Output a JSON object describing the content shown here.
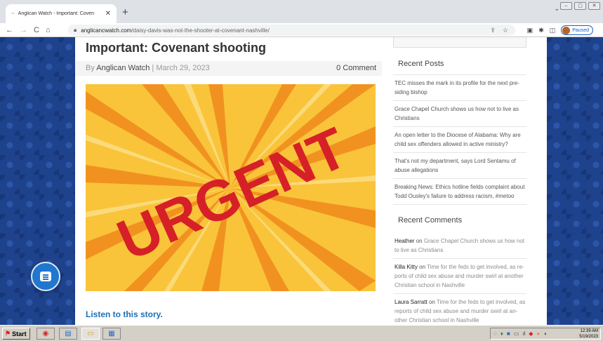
{
  "browser": {
    "tab_title": "Anglican Watch - Important: Coven",
    "tab_close": "✕",
    "new_tab": "+",
    "url_host": "anglicancwatch.com",
    "url_path": "/daisy-davis-was-not-the-shooter-at-covenant-nashville/",
    "profile_status": "Paused",
    "nav": {
      "back": "←",
      "forward": "→",
      "reload": "C",
      "home": "⌂"
    }
  },
  "post": {
    "title": "Important: Covenant shooting",
    "by_label": "By",
    "author": "Anglican Watch",
    "separator": "|",
    "date": "March 29, 2023",
    "comments": "0 Comment",
    "image_text": "URGENT",
    "listen_link": "Listen to this story."
  },
  "sidebar": {
    "recent_posts_title": "Recent Posts",
    "recent_posts": [
      "TEC misses the mark in its profile for the next pre-siding bishop",
      "Grace Chapel Church shows us how not to live as Christians",
      "An open letter to the Diocese of Alabama: Why are child sex offenders allowed in active ministry?",
      "That's not my department, says Lord Sentamu of abuse allegations",
      "Breaking News: Ethics hotline fields complaint about Todd Ousley's failure to address racism, #metoo"
    ],
    "recent_comments_title": "Recent Comments",
    "recent_comments": [
      {
        "author": "Heather",
        "on": "on",
        "link": "Grace Chapel Church shows us how not to live as Christians"
      },
      {
        "author": "Killa Kitty",
        "on": "on",
        "link": "Time for the feds to get involved, as re-ports of child sex abuse and murder swirl at another Christian school in Nashville"
      },
      {
        "author": "Laura Sarratt",
        "on": "on",
        "link": "Time for the feds to get involved, as reports of child sex abuse and murder swirl at an-other Christian school in Nashville"
      }
    ]
  },
  "taskbar": {
    "start_label": "Start",
    "clock_time": "12:39 AM",
    "clock_date": "5/19/2023"
  },
  "colors": {
    "background_blue": "#1c3f86",
    "link_blue": "#1a70b8",
    "urgent_red": "#d62027",
    "urgent_yellow": "#f9c43a"
  },
  "icons": [
    "lock-icon",
    "share-icon",
    "star-icon",
    "extension-icon",
    "sidebar-icon",
    "chat-icon",
    "windows-logo-icon"
  ]
}
